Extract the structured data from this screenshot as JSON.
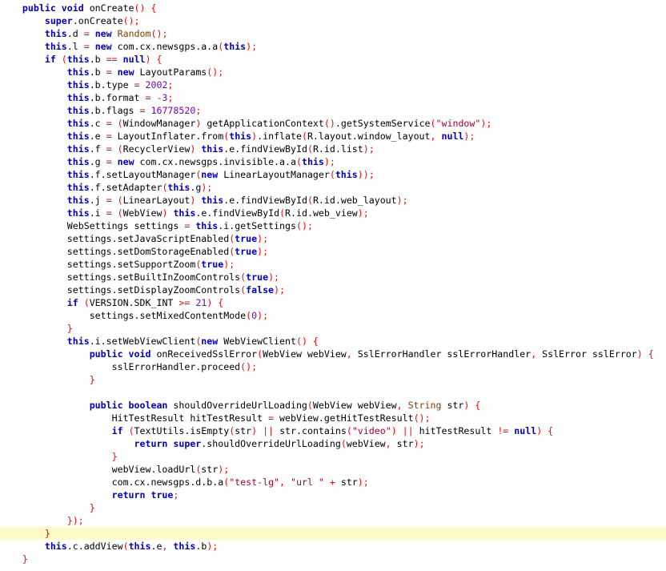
{
  "colors": {
    "background": "#ffffff",
    "keyword": "#0000c0",
    "class_name": "#7f3f00",
    "string": "#b00020",
    "number": "#7a00c0",
    "punctuation": "#ff0000",
    "text": "#000000",
    "line_highlight": "#fffbc8"
  },
  "editor": {
    "highlighted_line": 42,
    "lines": [
      {
        "i": 1,
        "t": [
          [
            "kw",
            "public void "
          ],
          [
            "txt",
            "onCreate"
          ],
          [
            "pun",
            "() {"
          ]
        ]
      },
      {
        "i": 2,
        "t": [
          [
            "kw",
            "super"
          ],
          [
            "txt",
            ".onCreate"
          ],
          [
            "pun",
            "();"
          ]
        ]
      },
      {
        "i": 2,
        "t": [
          [
            "kw",
            "this"
          ],
          [
            "txt",
            ".d "
          ],
          [
            "pun",
            "= "
          ],
          [
            "kw",
            "new "
          ],
          [
            "cls",
            "Random"
          ],
          [
            "pun",
            "();"
          ]
        ]
      },
      {
        "i": 2,
        "t": [
          [
            "kw",
            "this"
          ],
          [
            "txt",
            ".l "
          ],
          [
            "pun",
            "= "
          ],
          [
            "kw",
            "new "
          ],
          [
            "txt",
            "com.cx.newsgps.a.a"
          ],
          [
            "pun",
            "("
          ],
          [
            "kw",
            "this"
          ],
          [
            "pun",
            ");"
          ]
        ]
      },
      {
        "i": 2,
        "t": [
          [
            "kw",
            "if "
          ],
          [
            "pun",
            "("
          ],
          [
            "kw",
            "this"
          ],
          [
            "txt",
            ".b "
          ],
          [
            "pun",
            "== "
          ],
          [
            "kw",
            "null"
          ],
          [
            "pun",
            ") {"
          ]
        ]
      },
      {
        "i": 3,
        "t": [
          [
            "kw",
            "this"
          ],
          [
            "txt",
            ".b "
          ],
          [
            "pun",
            "= "
          ],
          [
            "kw",
            "new "
          ],
          [
            "txt",
            "LayoutParams"
          ],
          [
            "pun",
            "();"
          ]
        ]
      },
      {
        "i": 3,
        "t": [
          [
            "kw",
            "this"
          ],
          [
            "txt",
            ".b.type "
          ],
          [
            "pun",
            "= "
          ],
          [
            "num",
            "2002"
          ],
          [
            "pun",
            ";"
          ]
        ]
      },
      {
        "i": 3,
        "t": [
          [
            "kw",
            "this"
          ],
          [
            "txt",
            ".b.format "
          ],
          [
            "pun",
            "= -"
          ],
          [
            "num",
            "3"
          ],
          [
            "pun",
            ";"
          ]
        ]
      },
      {
        "i": 3,
        "t": [
          [
            "kw",
            "this"
          ],
          [
            "txt",
            ".b.flags "
          ],
          [
            "pun",
            "= "
          ],
          [
            "num",
            "16778520"
          ],
          [
            "pun",
            ";"
          ]
        ]
      },
      {
        "i": 3,
        "t": [
          [
            "kw",
            "this"
          ],
          [
            "txt",
            ".c "
          ],
          [
            "pun",
            "= ("
          ],
          [
            "txt",
            "WindowManager"
          ],
          [
            "pun",
            ") "
          ],
          [
            "txt",
            "getApplicationContext"
          ],
          [
            "pun",
            "()"
          ],
          [
            "txt",
            ".getSystemService"
          ],
          [
            "pun",
            "("
          ],
          [
            "str",
            "\"window\""
          ],
          [
            "pun",
            ");"
          ]
        ]
      },
      {
        "i": 3,
        "t": [
          [
            "kw",
            "this"
          ],
          [
            "txt",
            ".e "
          ],
          [
            "pun",
            "= "
          ],
          [
            "txt",
            "LayoutInflater.from"
          ],
          [
            "pun",
            "("
          ],
          [
            "kw",
            "this"
          ],
          [
            "pun",
            ")"
          ],
          [
            "txt",
            ".inflate"
          ],
          [
            "pun",
            "("
          ],
          [
            "txt",
            "R.layout.window_layout"
          ],
          [
            "pun",
            ", "
          ],
          [
            "kw",
            "null"
          ],
          [
            "pun",
            ");"
          ]
        ]
      },
      {
        "i": 3,
        "t": [
          [
            "kw",
            "this"
          ],
          [
            "txt",
            ".f "
          ],
          [
            "pun",
            "= ("
          ],
          [
            "txt",
            "RecyclerView"
          ],
          [
            "pun",
            ") "
          ],
          [
            "kw",
            "this"
          ],
          [
            "txt",
            ".e.findViewById"
          ],
          [
            "pun",
            "("
          ],
          [
            "txt",
            "R.id.list"
          ],
          [
            "pun",
            ");"
          ]
        ]
      },
      {
        "i": 3,
        "t": [
          [
            "kw",
            "this"
          ],
          [
            "txt",
            ".g "
          ],
          [
            "pun",
            "= "
          ],
          [
            "kw",
            "new "
          ],
          [
            "txt",
            "com.cx.newsgps.invisible.a.a"
          ],
          [
            "pun",
            "("
          ],
          [
            "kw",
            "this"
          ],
          [
            "pun",
            ");"
          ]
        ]
      },
      {
        "i": 3,
        "t": [
          [
            "kw",
            "this"
          ],
          [
            "txt",
            ".f.setLayoutManager"
          ],
          [
            "pun",
            "("
          ],
          [
            "kw",
            "new "
          ],
          [
            "txt",
            "LinearLayoutManager"
          ],
          [
            "pun",
            "("
          ],
          [
            "kw",
            "this"
          ],
          [
            "pun",
            "));"
          ]
        ]
      },
      {
        "i": 3,
        "t": [
          [
            "kw",
            "this"
          ],
          [
            "txt",
            ".f.setAdapter"
          ],
          [
            "pun",
            "("
          ],
          [
            "kw",
            "this"
          ],
          [
            "txt",
            ".g"
          ],
          [
            "pun",
            ");"
          ]
        ]
      },
      {
        "i": 3,
        "t": [
          [
            "kw",
            "this"
          ],
          [
            "txt",
            ".j "
          ],
          [
            "pun",
            "= ("
          ],
          [
            "txt",
            "LinearLayout"
          ],
          [
            "pun",
            ") "
          ],
          [
            "kw",
            "this"
          ],
          [
            "txt",
            ".e.findViewById"
          ],
          [
            "pun",
            "("
          ],
          [
            "txt",
            "R.id.web_layout"
          ],
          [
            "pun",
            ");"
          ]
        ]
      },
      {
        "i": 3,
        "t": [
          [
            "kw",
            "this"
          ],
          [
            "txt",
            ".i "
          ],
          [
            "pun",
            "= ("
          ],
          [
            "txt",
            "WebView"
          ],
          [
            "pun",
            ") "
          ],
          [
            "kw",
            "this"
          ],
          [
            "txt",
            ".e.findViewById"
          ],
          [
            "pun",
            "("
          ],
          [
            "txt",
            "R.id.web_view"
          ],
          [
            "pun",
            ");"
          ]
        ]
      },
      {
        "i": 3,
        "t": [
          [
            "txt",
            "WebSettings settings "
          ],
          [
            "pun",
            "= "
          ],
          [
            "kw",
            "this"
          ],
          [
            "txt",
            ".i.getSettings"
          ],
          [
            "pun",
            "();"
          ]
        ]
      },
      {
        "i": 3,
        "t": [
          [
            "txt",
            "settings.setJavaScriptEnabled"
          ],
          [
            "pun",
            "("
          ],
          [
            "kw",
            "true"
          ],
          [
            "pun",
            ");"
          ]
        ]
      },
      {
        "i": 3,
        "t": [
          [
            "txt",
            "settings.setDomStorageEnabled"
          ],
          [
            "pun",
            "("
          ],
          [
            "kw",
            "true"
          ],
          [
            "pun",
            ");"
          ]
        ]
      },
      {
        "i": 3,
        "t": [
          [
            "txt",
            "settings.setSupportZoom"
          ],
          [
            "pun",
            "("
          ],
          [
            "kw",
            "true"
          ],
          [
            "pun",
            ");"
          ]
        ]
      },
      {
        "i": 3,
        "t": [
          [
            "txt",
            "settings.setBuiltInZoomControls"
          ],
          [
            "pun",
            "("
          ],
          [
            "kw",
            "true"
          ],
          [
            "pun",
            ");"
          ]
        ]
      },
      {
        "i": 3,
        "t": [
          [
            "txt",
            "settings.setDisplayZoomControls"
          ],
          [
            "pun",
            "("
          ],
          [
            "kw",
            "false"
          ],
          [
            "pun",
            ");"
          ]
        ]
      },
      {
        "i": 3,
        "t": [
          [
            "kw",
            "if "
          ],
          [
            "pun",
            "("
          ],
          [
            "txt",
            "VERSION.SDK_INT "
          ],
          [
            "pun",
            ">= "
          ],
          [
            "num",
            "21"
          ],
          [
            "pun",
            ") {"
          ]
        ]
      },
      {
        "i": 4,
        "t": [
          [
            "txt",
            "settings.setMixedContentMode"
          ],
          [
            "pun",
            "("
          ],
          [
            "num",
            "0"
          ],
          [
            "pun",
            ");"
          ]
        ]
      },
      {
        "i": 3,
        "t": [
          [
            "pun",
            "}"
          ]
        ]
      },
      {
        "i": 3,
        "t": [
          [
            "kw",
            "this"
          ],
          [
            "txt",
            ".i.setWebViewClient"
          ],
          [
            "pun",
            "("
          ],
          [
            "kw",
            "new "
          ],
          [
            "txt",
            "WebViewClient"
          ],
          [
            "pun",
            "() {"
          ]
        ]
      },
      {
        "i": 4,
        "t": [
          [
            "kw",
            "public void "
          ],
          [
            "txt",
            "onReceivedSslError"
          ],
          [
            "pun",
            "("
          ],
          [
            "txt",
            "WebView webView"
          ],
          [
            "pun",
            ", "
          ],
          [
            "txt",
            "SslErrorHandler sslErrorHandler"
          ],
          [
            "pun",
            ", "
          ],
          [
            "txt",
            "SslError sslError"
          ],
          [
            "pun",
            ") {"
          ]
        ]
      },
      {
        "i": 5,
        "t": [
          [
            "txt",
            "sslErrorHandler.proceed"
          ],
          [
            "pun",
            "();"
          ]
        ]
      },
      {
        "i": 4,
        "t": [
          [
            "pun",
            "}"
          ]
        ]
      },
      {
        "i": 0,
        "t": []
      },
      {
        "i": 4,
        "t": [
          [
            "kw",
            "public boolean "
          ],
          [
            "txt",
            "shouldOverrideUrlLoading"
          ],
          [
            "pun",
            "("
          ],
          [
            "txt",
            "WebView webView"
          ],
          [
            "pun",
            ", "
          ],
          [
            "cls",
            "String "
          ],
          [
            "txt",
            "str"
          ],
          [
            "pun",
            ") {"
          ]
        ]
      },
      {
        "i": 5,
        "t": [
          [
            "txt",
            "HitTestResult hitTestResult "
          ],
          [
            "pun",
            "= "
          ],
          [
            "txt",
            "webView.getHitTestResult"
          ],
          [
            "pun",
            "();"
          ]
        ]
      },
      {
        "i": 5,
        "t": [
          [
            "kw",
            "if "
          ],
          [
            "pun",
            "("
          ],
          [
            "txt",
            "TextUtils.isEmpty"
          ],
          [
            "pun",
            "("
          ],
          [
            "txt",
            "str"
          ],
          [
            "pun",
            ") || "
          ],
          [
            "txt",
            "str.contains"
          ],
          [
            "pun",
            "("
          ],
          [
            "str",
            "\"video\""
          ],
          [
            "pun",
            ") || "
          ],
          [
            "txt",
            "hitTestResult "
          ],
          [
            "pun",
            "!= "
          ],
          [
            "kw",
            "null"
          ],
          [
            "pun",
            ") {"
          ]
        ]
      },
      {
        "i": 6,
        "t": [
          [
            "kw",
            "return super"
          ],
          [
            "txt",
            ".shouldOverrideUrlLoading"
          ],
          [
            "pun",
            "("
          ],
          [
            "txt",
            "webView"
          ],
          [
            "pun",
            ", "
          ],
          [
            "txt",
            "str"
          ],
          [
            "pun",
            ");"
          ]
        ]
      },
      {
        "i": 5,
        "t": [
          [
            "pun",
            "}"
          ]
        ]
      },
      {
        "i": 5,
        "t": [
          [
            "txt",
            "webView.loadUrl"
          ],
          [
            "pun",
            "("
          ],
          [
            "txt",
            "str"
          ],
          [
            "pun",
            ");"
          ]
        ]
      },
      {
        "i": 5,
        "t": [
          [
            "txt",
            "com.cx.newsgps.d.b.a"
          ],
          [
            "pun",
            "("
          ],
          [
            "str",
            "\"test-lg\""
          ],
          [
            "pun",
            ", "
          ],
          [
            "str",
            "\"url \" "
          ],
          [
            "pun",
            "+ "
          ],
          [
            "txt",
            "str"
          ],
          [
            "pun",
            ");"
          ]
        ]
      },
      {
        "i": 5,
        "t": [
          [
            "kw",
            "return true"
          ],
          [
            "pun",
            ";"
          ]
        ]
      },
      {
        "i": 4,
        "t": [
          [
            "pun",
            "}"
          ]
        ]
      },
      {
        "i": 3,
        "t": [
          [
            "pun",
            "});"
          ]
        ]
      },
      {
        "i": 2,
        "t": [
          [
            "pun",
            "}"
          ]
        ]
      },
      {
        "i": 2,
        "t": [
          [
            "kw",
            "this"
          ],
          [
            "txt",
            ".c.addView"
          ],
          [
            "pun",
            "("
          ],
          [
            "kw",
            "this"
          ],
          [
            "txt",
            ".e"
          ],
          [
            "pun",
            ", "
          ],
          [
            "kw",
            "this"
          ],
          [
            "txt",
            ".b"
          ],
          [
            "pun",
            ");"
          ]
        ]
      },
      {
        "i": 1,
        "t": [
          [
            "pun",
            "}"
          ]
        ]
      }
    ]
  }
}
